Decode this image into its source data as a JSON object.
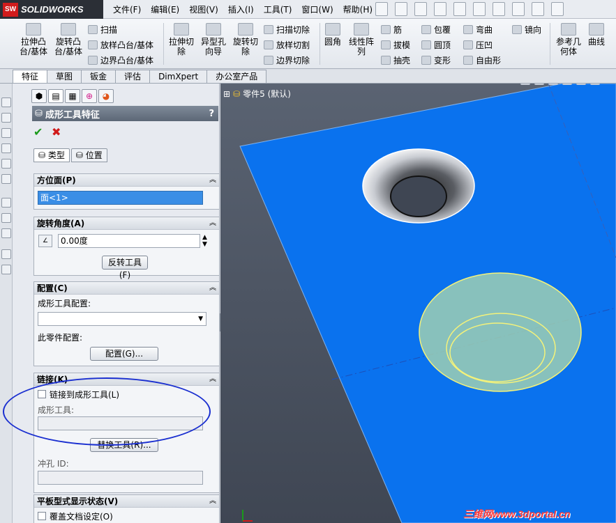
{
  "app": {
    "brand_logo": "SW",
    "brand_name": "SOLIDWORKS"
  },
  "menu": [
    "文件(F)",
    "编辑(E)",
    "视图(V)",
    "插入(I)",
    "工具(T)",
    "窗口(W)",
    "帮助(H)"
  ],
  "ribbon": {
    "extrude_boss": "拉伸凸\n台/基体",
    "revolve_boss": "旋转凸\n台/基体",
    "sweep": "扫描",
    "loft_boss": "放样凸台/基体",
    "boundary_boss": "边界凸台/基体",
    "extrude_cut": "拉伸切\n除",
    "hole_wizard": "异型孔\n向导",
    "revolve_cut": "旋转切\n除",
    "sweep_cut": "扫描切除",
    "loft_cut": "放样切割",
    "boundary_cut": "边界切除",
    "fillet": "圆角",
    "linear_pattern": "线性阵\n列",
    "rib": "筋",
    "draft": "拔模",
    "shell": "抽壳",
    "wrap": "包覆",
    "dome": "圆顶",
    "deform": "变形",
    "flex": "弯曲",
    "indent": "压凹",
    "freeform": "自由形",
    "mirror": "镜向",
    "reference_geometry": "参考几\n何体",
    "curves": "曲线"
  },
  "tabs": [
    "特征",
    "草图",
    "钣金",
    "评估",
    "DimXpert",
    "办公室产品"
  ],
  "property_manager": {
    "title": "成形工具特征",
    "help": "?",
    "ok": "✔",
    "cancel": "✖",
    "subtabs": [
      "类型",
      "位置"
    ],
    "orientation_face": {
      "header": "方位面(P)",
      "value": "面<1>"
    },
    "rotation_angle": {
      "header": "旋转角度(A)",
      "value": "0.00度",
      "flip_button": "反转工具(F)"
    },
    "configuration": {
      "header": "配置(C)",
      "tool_config_label": "成形工具配置:",
      "tool_config_value": "",
      "part_config_label": "此零件配置:",
      "config_button": "配置(G)..."
    },
    "link": {
      "header": "链接(K)",
      "checkbox_label": "链接到成形工具(L)",
      "tool_label": "成形工具:",
      "tool_value": "",
      "replace_button": "替换工具(R)...",
      "punch_id_label": "冲孔 ID:",
      "punch_id_value": ""
    },
    "flat_pattern": {
      "header": "平板型式显示状态(V)",
      "checkbox_label": "覆盖文档设定(O)"
    }
  },
  "viewport": {
    "tree_label": "零件5 (默认)"
  },
  "watermark": "三维网www.3dportal.cn",
  "colors": {
    "plate": "#0a72ee",
    "highlight_fill": "#9fcfb3",
    "highlight_edge": "#f4f27a",
    "annotation": "#1a2fd0"
  }
}
